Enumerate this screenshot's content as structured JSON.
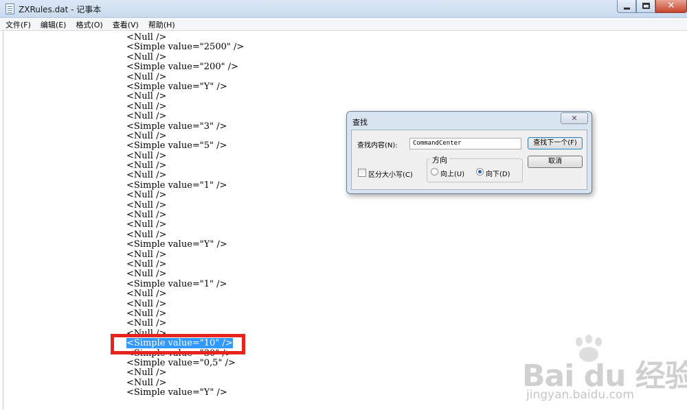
{
  "window": {
    "title": "ZXRules.dat - 记事本",
    "minimize_label": "—",
    "close_label": "✕"
  },
  "menu": [
    "文件(F)",
    "编辑(E)",
    "格式(O)",
    "查看(V)",
    "帮助(H)"
  ],
  "editor": {
    "lines": [
      "<Null />",
      "<Simple value=\"2500\" />",
      "<Null />",
      "<Simple value=\"200\" />",
      "<Null />",
      "<Simple value=\"Y\" />",
      "<Null />",
      "<Null />",
      "<Null />",
      "<Simple value=\"3\" />",
      "<Null />",
      "<Simple value=\"5\" />",
      "<Null />",
      "<Null />",
      "<Null />",
      "<Simple value=\"1\" />",
      "<Null />",
      "<Null />",
      "<Null />",
      "<Null />",
      "<Null />",
      "<Simple value=\"Y\" />",
      "<Null />",
      "<Null />",
      "<Null />",
      "<Simple value=\"1\" />",
      "<Null />",
      "<Null />",
      "<Null />",
      "<Null />",
      "<Null />",
      "<Simple value=\"10\" />",
      "<Simple value=\"30\" />",
      "<Simple value=\"0,5\" />",
      "<Null />",
      "<Null />",
      "<Simple value=\"Y\" />"
    ],
    "selected_line_index": 31
  },
  "find_dialog": {
    "title": "查找",
    "close_label": "✕",
    "find_label": "查找内容(N):",
    "find_value": "CommandCenter",
    "find_next_button": "查找下一个(F)",
    "cancel_button": "取消",
    "match_case_label": "区分大小写(C)",
    "match_case_checked": false,
    "direction_label": "方向",
    "up_label": "向上(U)",
    "down_label": "向下(D)",
    "direction_selected": "down"
  },
  "watermark": {
    "brand": "Bai du 经验",
    "url": "jingyan.baidu.com"
  }
}
